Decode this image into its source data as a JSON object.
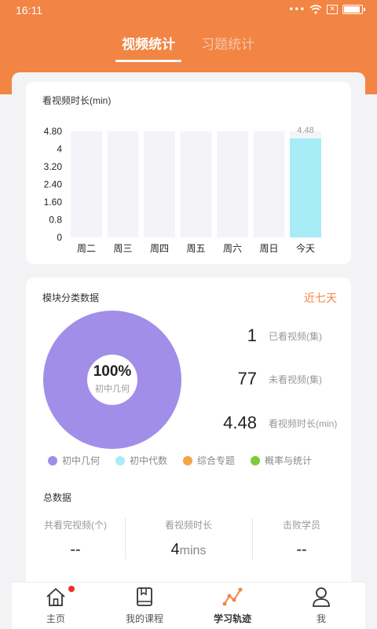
{
  "status": {
    "time": "16:11",
    "dots": "•••"
  },
  "tabs": [
    {
      "label": "视频统计",
      "active": true
    },
    {
      "label": "习题统计",
      "active": false
    }
  ],
  "chart_card": {
    "title": "看视频时长(min)"
  },
  "chart_data": {
    "type": "bar",
    "title": "看视频时长(min)",
    "categories": [
      "周二",
      "周三",
      "周四",
      "周五",
      "周六",
      "周日",
      "今天"
    ],
    "values": [
      0,
      0,
      0,
      0,
      0,
      0,
      4.48
    ],
    "value_labels": [
      "",
      "",
      "",
      "",
      "",
      "",
      "4.48"
    ],
    "ylim": [
      0,
      4.8
    ],
    "yticks": [
      "4.80",
      "4",
      "3.20",
      "2.40",
      "1.60",
      "0.8",
      "0"
    ],
    "colors": {
      "bar": "#a8ecf7",
      "background": "#f4f4f8"
    },
    "grid": false
  },
  "module_card": {
    "title": "模块分类数据",
    "range_label": "近七天",
    "pie_center_value": "100%",
    "pie_center_label": "初中几何",
    "pie": {
      "slices": [
        {
          "name": "初中几何",
          "value": 100,
          "color": "#a18ee8"
        }
      ]
    },
    "stats": [
      {
        "value": "1",
        "label": "已看视频(集)"
      },
      {
        "value": "77",
        "label": "未看视频(集)"
      },
      {
        "value": "4.48",
        "label": "看视频时长(min)"
      }
    ],
    "legend": [
      {
        "label": "初中几何",
        "color": "#a18ee8"
      },
      {
        "label": "初中代数",
        "color": "#a8ecf7"
      },
      {
        "label": "综合专题",
        "color": "#f3a548"
      },
      {
        "label": "概率与统计",
        "color": "#7ccc3a"
      }
    ]
  },
  "totals": {
    "title": "总数据",
    "cols": [
      {
        "label": "共看完视频(个)",
        "value": "--",
        "unit": ""
      },
      {
        "label": "看视频时长",
        "value": "4",
        "unit": "mins"
      },
      {
        "label": "击败学员",
        "value": "--",
        "unit": ""
      }
    ]
  },
  "nav": [
    {
      "label": "主页",
      "icon": "home-icon",
      "badge": true
    },
    {
      "label": "我的课程",
      "icon": "book-icon"
    },
    {
      "label": "学习轨迹",
      "icon": "trend-icon",
      "active": true
    },
    {
      "label": "我",
      "icon": "user-icon"
    }
  ],
  "colors": {
    "brand": "#f28444"
  }
}
